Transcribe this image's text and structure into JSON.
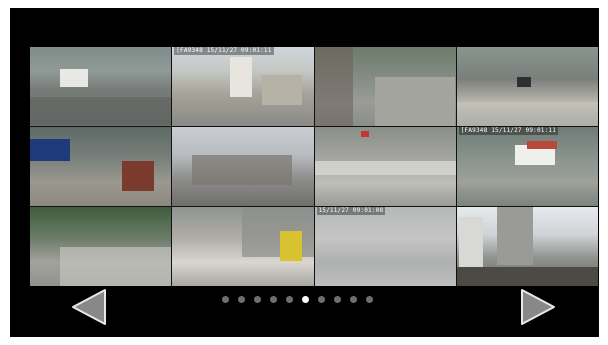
{
  "cameras": [
    {
      "id": "cam-1",
      "stamp": ""
    },
    {
      "id": "cam-2",
      "stamp": "[FA9348  15/11/27  09:01:11"
    },
    {
      "id": "cam-3",
      "stamp": ""
    },
    {
      "id": "cam-4",
      "stamp": ""
    },
    {
      "id": "cam-5",
      "stamp": ""
    },
    {
      "id": "cam-6",
      "stamp": ""
    },
    {
      "id": "cam-7",
      "stamp": ""
    },
    {
      "id": "cam-8",
      "stamp": "[FA9348  15/11/27  09:01:11"
    },
    {
      "id": "cam-9",
      "stamp": ""
    },
    {
      "id": "cam-10",
      "stamp": ""
    },
    {
      "id": "cam-11",
      "stamp": "15/11/27  09:01:08"
    },
    {
      "id": "cam-12",
      "stamp": ""
    }
  ],
  "pager": {
    "total_pages": 10,
    "current_page": 6
  },
  "icons": {
    "prev": "left-triangle-icon",
    "next": "right-triangle-icon"
  }
}
